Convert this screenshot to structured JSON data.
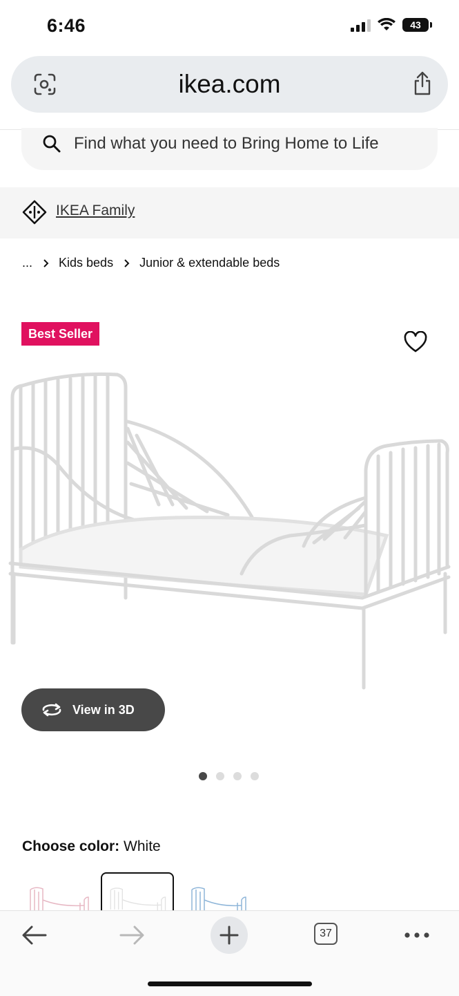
{
  "status": {
    "time": "6:46",
    "battery": "43"
  },
  "browser": {
    "url": "ikea.com",
    "tab_count": "37"
  },
  "search": {
    "placeholder": "Find what you need to Bring Home to Life"
  },
  "family": {
    "label": "IKEA Family"
  },
  "breadcrumb": {
    "ellipsis": "...",
    "items": [
      "Kids beds",
      "Junior & extendable beds"
    ]
  },
  "product": {
    "badge": "Best Seller",
    "view_3d_label": "View in 3D",
    "image_count": 4,
    "active_image": 1,
    "color_prompt": "Choose color:",
    "color_value": "White",
    "swatch_colors": [
      "#e7b8c4",
      "#e6e6e6",
      "#8fb6d9"
    ],
    "selected_swatch": 2
  },
  "colors": {
    "badge": "#e0115f",
    "view3d_bg": "#484848",
    "urlbar_bg": "#e9ecef"
  }
}
